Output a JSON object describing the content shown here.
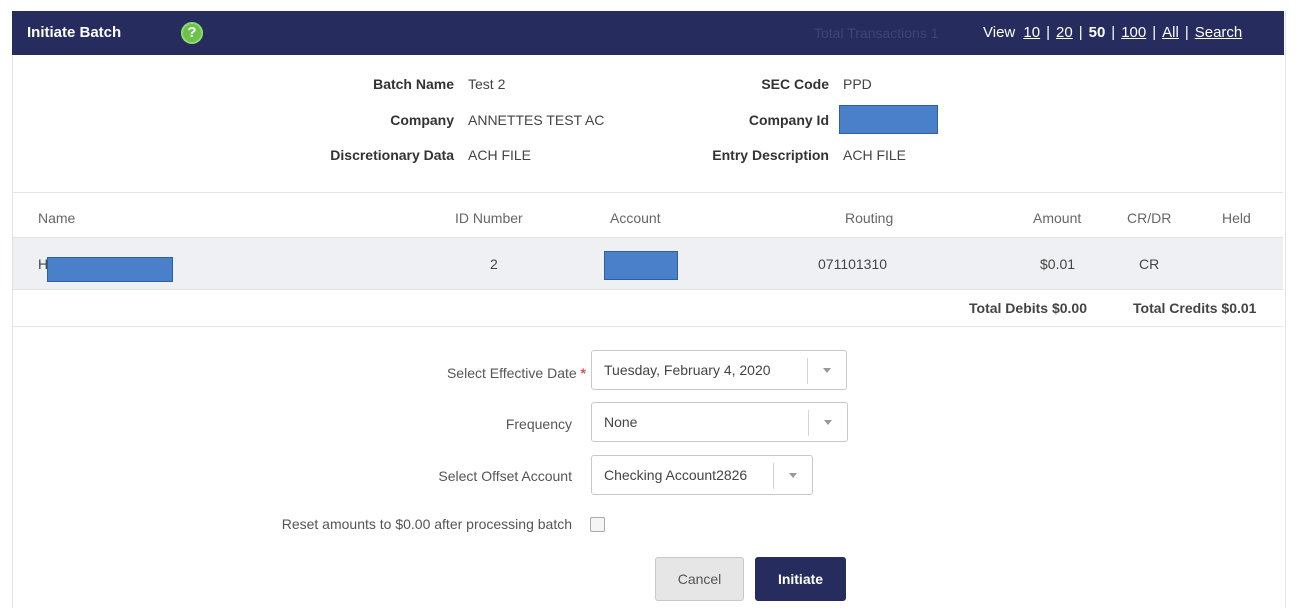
{
  "header": {
    "title": "Initiate Batch",
    "help_icon": "?",
    "total_transactions": "Total Transactions 1",
    "view_label": "View",
    "view_options": [
      "10",
      "20",
      "50",
      "100",
      "All",
      "Search"
    ],
    "view_selected": "50"
  },
  "batch": {
    "batch_name_label": "Batch Name",
    "batch_name": "Test 2",
    "company_label": "Company",
    "company": "ANNETTES TEST AC",
    "discretionary_label": "Discretionary Data",
    "discretionary": "ACH FILE",
    "sec_code_label": "SEC Code",
    "sec_code": "PPD",
    "company_id_label": "Company Id",
    "entry_desc_label": "Entry Description",
    "entry_desc": "ACH FILE"
  },
  "table": {
    "columns": [
      "Name",
      "ID Number",
      "Account",
      "Routing",
      "Amount",
      "CR/DR",
      "Held"
    ],
    "rows": [
      {
        "name": "H",
        "id_number": "2",
        "routing": "071101310",
        "amount": "$0.01",
        "crdr": "CR",
        "held": ""
      }
    ],
    "total_debits": "Total Debits $0.00",
    "total_credits": "Total Credits $0.01"
  },
  "form": {
    "effective_date_label": "Select Effective Date",
    "required_mark": "*",
    "effective_date_value": "Tuesday, February 4, 2020",
    "frequency_label": "Frequency",
    "frequency_value": "None",
    "offset_label": "Select Offset Account",
    "offset_value": "Checking Account2826",
    "reset_label": "Reset amounts to $0.00 after processing batch",
    "reset_checked": false,
    "cancel_label": "Cancel",
    "initiate_label": "Initiate"
  },
  "colors": {
    "header_bg": "#262d5e",
    "help_green": "#6cc24a",
    "redaction_blue": "#4a7fc9",
    "row_bg": "#eef0f3"
  },
  "icons": {
    "help": "help-circle-icon",
    "dropdown": "chevron-down-icon",
    "checkbox": "checkbox-icon"
  }
}
